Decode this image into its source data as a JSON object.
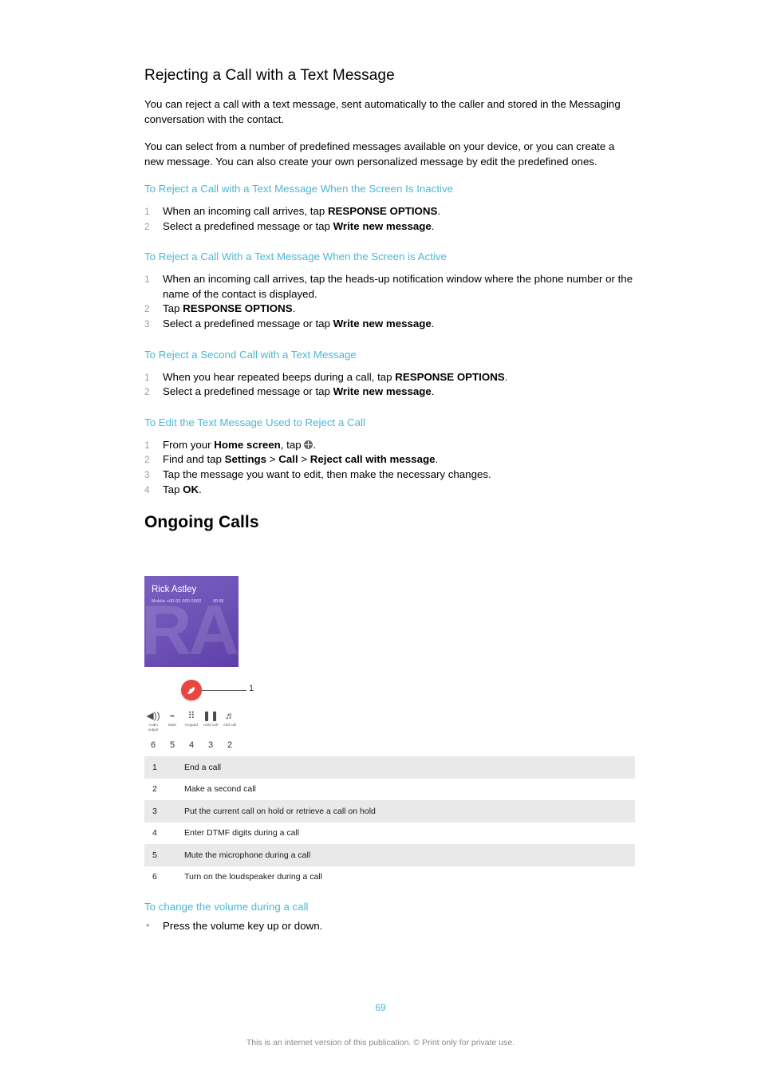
{
  "document": {
    "page_number": "69",
    "footer": "This is an internet version of this publication. © Print only for private use."
  },
  "section1": {
    "title": "Rejecting a Call with a Text Message",
    "paragraphs": [
      "You can reject a call with a text message, sent automatically to the caller and stored in the Messaging conversation with the contact.",
      "You can select from a number of predefined messages available on your device, or you can create a new message. You can also create your own personalized message by edit the predefined ones."
    ],
    "groups": [
      {
        "heading": "To Reject a Call with a Text Message When the Screen Is Inactive",
        "steps": [
          "When an incoming call arrives, tap RESPONSE OPTIONS.",
          "Select a predefined message or tap Write new message."
        ]
      },
      {
        "heading": "To Reject a Call With a Text Message When the Screen is Active",
        "steps": [
          "When an incoming call arrives, tap the heads-up notification window where the phone number or the name of the contact is displayed.",
          "Tap RESPONSE OPTIONS.",
          "Select a predefined message or tap Write new message."
        ]
      },
      {
        "heading": "To Reject a Second Call with a Text Message",
        "steps": [
          "When you hear repeated beeps during a call, tap RESPONSE OPTIONS.",
          "Select a predefined message or tap Write new message."
        ]
      },
      {
        "heading": "To Edit the Text Message Used to Reject a Call",
        "steps": [
          "From your Home screen, tap (apps icon).",
          "Find and tap Settings > Call > Reject call with message.",
          "Tap the message you want to edit, then make the necessary changes.",
          "Tap OK."
        ]
      }
    ]
  },
  "section2": {
    "title": "Ongoing Calls",
    "phone_mockup": {
      "contact_name": "Rick Astley",
      "contact_number": "Mobile +00 00 000 0000",
      "call_duration": "00:36",
      "initials_watermark": "RA",
      "end_call_callout": "1",
      "icons": [
        {
          "name": "audio-output-icon",
          "glyph": "◀))",
          "label": "Audio\noutput",
          "number": "6"
        },
        {
          "name": "mute-icon",
          "glyph": "⌁",
          "label": "Mute",
          "number": "5"
        },
        {
          "name": "keypad-icon",
          "glyph": "⠿",
          "label": "Keypad",
          "number": "4"
        },
        {
          "name": "hold-call-icon",
          "glyph": "❚❚",
          "label": "Hold call",
          "number": "3"
        },
        {
          "name": "add-call-icon",
          "glyph": "♫",
          "label": "Add call",
          "number": "2"
        }
      ]
    },
    "legend_rows": [
      {
        "n": "1",
        "desc": "End a call"
      },
      {
        "n": "2",
        "desc": "Make a second call"
      },
      {
        "n": "3",
        "desc": "Put the current call on hold or retrieve a call on hold"
      },
      {
        "n": "4",
        "desc": "Enter DTMF digits during a call"
      },
      {
        "n": "5",
        "desc": "Mute the microphone during a call"
      },
      {
        "n": "6",
        "desc": "Turn on the loudspeaker during a call"
      }
    ],
    "tail": {
      "heading": "To change the volume during a call",
      "bullet": "Press the volume key up or down."
    }
  },
  "colors": {
    "link_blue": "#4ab8d4",
    "step_number_gray": "#a0a0a0",
    "end_call_red": "#e8473f",
    "card_purple": "#6f54b8",
    "table_row_alt": "#e9e9e9"
  }
}
